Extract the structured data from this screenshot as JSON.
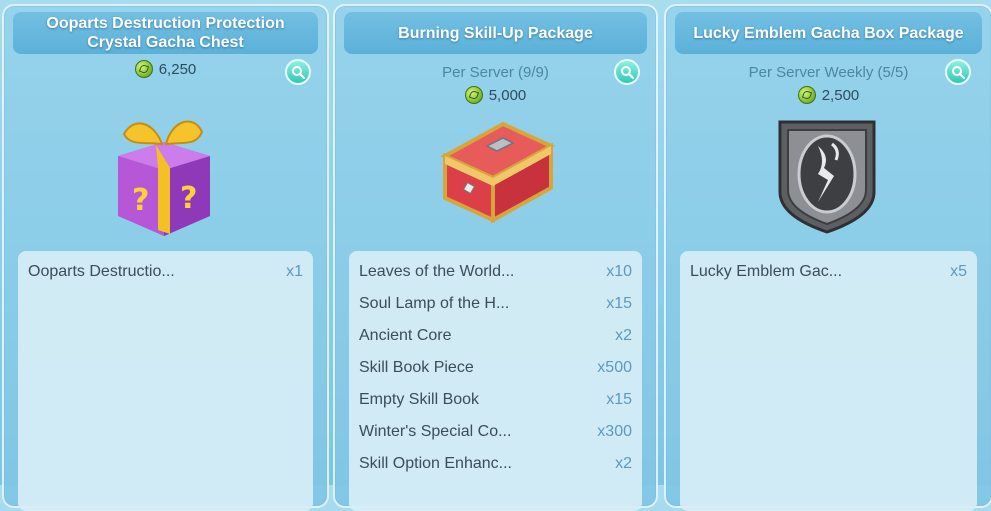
{
  "cards": [
    {
      "title": "Ooparts Destruction Protection\nCrystal Gacha Chest",
      "subtitle": "",
      "price": "6,250",
      "items": [
        {
          "name": "Ooparts Destructio...",
          "qty": "x1"
        }
      ]
    },
    {
      "title": "Burning Skill-Up Package",
      "subtitle": "Per Server (9/9)",
      "price": "5,000",
      "items": [
        {
          "name": "Leaves of the World...",
          "qty": "x10"
        },
        {
          "name": "Soul Lamp of the H...",
          "qty": "x15"
        },
        {
          "name": "Ancient Core",
          "qty": "x2"
        },
        {
          "name": "Skill Book Piece",
          "qty": "x500"
        },
        {
          "name": "Empty Skill Book",
          "qty": "x15"
        },
        {
          "name": "Winter's Special Co...",
          "qty": "x300"
        },
        {
          "name": "Skill Option Enhanc...",
          "qty": "x2"
        }
      ]
    },
    {
      "title": "Lucky Emblem Gacha Box Package",
      "subtitle": "Per Server Weekly (5/5)",
      "price": "2,500",
      "items": [
        {
          "name": "Lucky Emblem Gac...",
          "qty": "x5"
        }
      ]
    }
  ],
  "icons": {
    "currency": "green-leaf-coin-icon",
    "zoom": "magnifier-icon",
    "card1_image": "mystery-gift-box-icon",
    "card2_image": "red-treasure-chest-icon",
    "card3_image": "emblem-shield-icon"
  },
  "colors": {
    "title_bar": "#5cb1d9",
    "search_button": "#2fc8b8",
    "quantity_text": "#5a9bc2"
  }
}
